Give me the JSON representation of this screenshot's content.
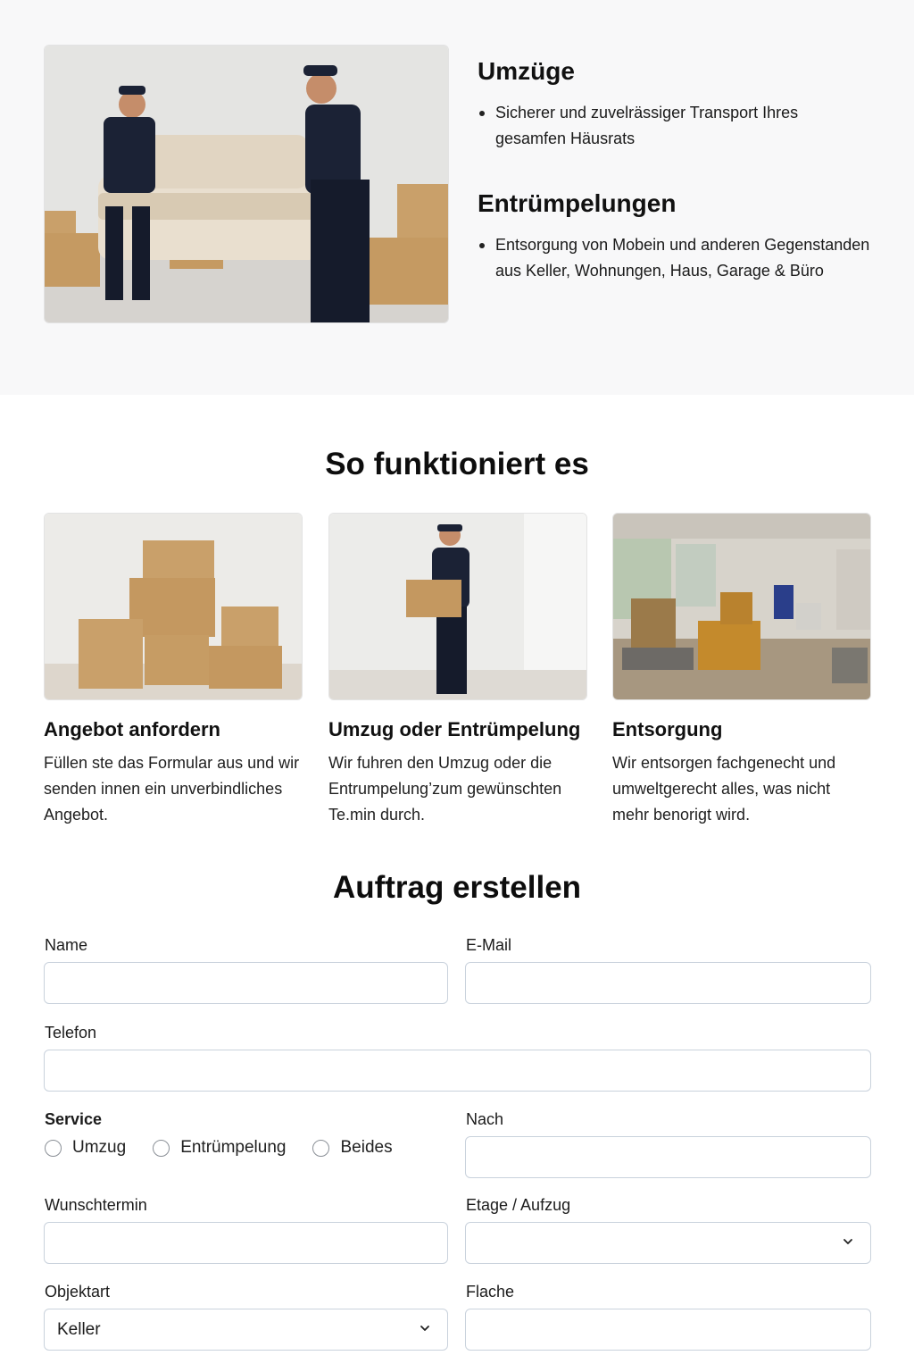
{
  "services": {
    "umzuege": {
      "title": "Umzüge",
      "bullets": [
        "Sicherer und zuvelrässiger Transport Ihres gesamfen Häusrats"
      ]
    },
    "entruempelungen": {
      "title": "Entrümpelungen",
      "bullets": [
        "Entsorgung von Mobein und anderen Gegenstanden aus Keller, Wohnungen, Haus, Garage & Büro"
      ]
    }
  },
  "how_it_works": {
    "title": "So funktioniert es",
    "steps": [
      {
        "title": "Angebot anfordern",
        "text": "Füllen ste das Formular aus und wir senden innen ein unverbindliches Angebot."
      },
      {
        "title": "Umzug oder Entrümpelung",
        "text": "Wir fuhren den Umzug oder die Entrumpelung’zum gewünschten Te.min durch."
      },
      {
        "title": "Entsorgung",
        "text": "Wir entsorgen fachgenecht und umweltgerecht alles, was nicht mehr benorigt wird."
      }
    ]
  },
  "form": {
    "title": "Auftrag erstellen",
    "name_label": "Name",
    "email_label": "E-Mail",
    "phone_label": "Telefon",
    "service_label": "Service",
    "service_options": [
      "Umzug",
      "Entrümpelung",
      "Beides"
    ],
    "nach_label": "Nach",
    "date_label": "Wunschtermin",
    "floor_label": "Etage / Aufzug",
    "floor_value": "",
    "object_label": "Objektart",
    "object_value": "Keller",
    "area_label": "Flache"
  }
}
